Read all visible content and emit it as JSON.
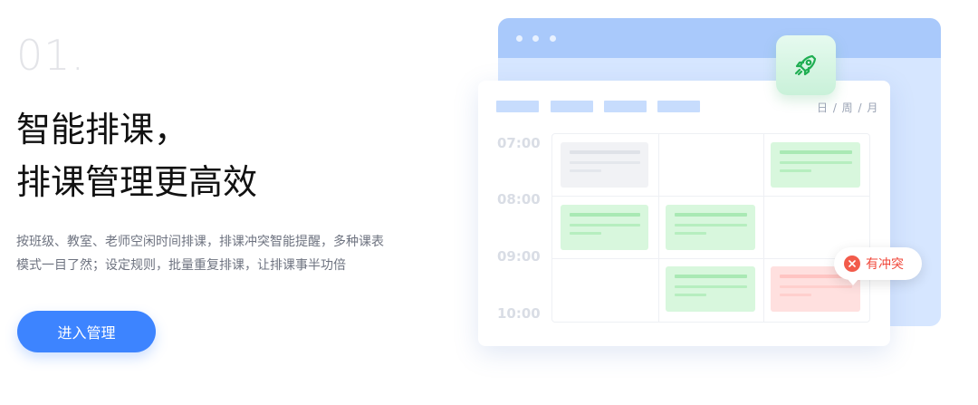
{
  "step_number": "01.",
  "headline": {
    "line1": "智能排课，",
    "line2": "排课管理更高效"
  },
  "description": {
    "line1": "按班级、教室、老师空闲时间排课，排课冲突智能提醒，多种课表",
    "line2": "模式一目了然；设定规则，批量重复排课，让排课事半功倍"
  },
  "cta_label": "进入管理",
  "illustration": {
    "view_switch": "日 / 周 / 月",
    "times": [
      "07:00",
      "08:00",
      "09:00",
      "10:00"
    ],
    "conflict_label": "有冲突",
    "badge_icon": "rocket-icon"
  },
  "colors": {
    "primary": "#3d84ff",
    "green_block": "#d8f7dd",
    "gray_block": "#f1f2f5",
    "red_block": "#ffe0df",
    "conflict": "#f25b4b"
  }
}
